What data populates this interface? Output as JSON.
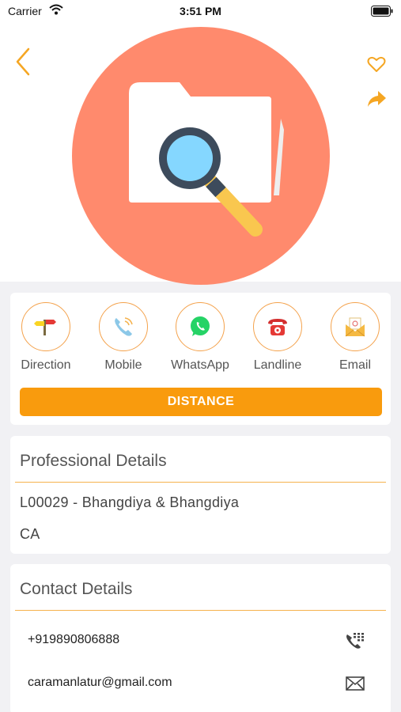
{
  "status_bar": {
    "carrier": "Carrier",
    "time": "3:51 PM"
  },
  "header": {
    "back_icon": "chevron-left-icon",
    "favorite_icon": "heart-outline-icon",
    "share_icon": "share-arrow-icon",
    "hero_image": "folder-search-illustration"
  },
  "actions": [
    {
      "label": "Direction",
      "icon": "direction-signpost-icon"
    },
    {
      "label": "Mobile",
      "icon": "mobile-phone-icon"
    },
    {
      "label": "WhatsApp",
      "icon": "whatsapp-icon"
    },
    {
      "label": "Landline",
      "icon": "landline-phone-icon"
    },
    {
      "label": "Email",
      "icon": "email-envelope-icon"
    }
  ],
  "distance_label": "DISTANCE",
  "professional": {
    "title": "Professional Details",
    "name": "L00029 - Bhangdiya & Bhangdiya",
    "designation": "CA"
  },
  "contact": {
    "title": "Contact Details",
    "phone": "+919890806888",
    "email": "caramanlatur@gmail.com",
    "phone_icon": "dialpad-phone-icon",
    "email_icon": "envelope-outline-icon"
  },
  "colors": {
    "accent": "#f99b0d",
    "icon_orange": "#f5a623",
    "hero_circle": "#ff8a6d",
    "background": "#f1f1f4"
  }
}
